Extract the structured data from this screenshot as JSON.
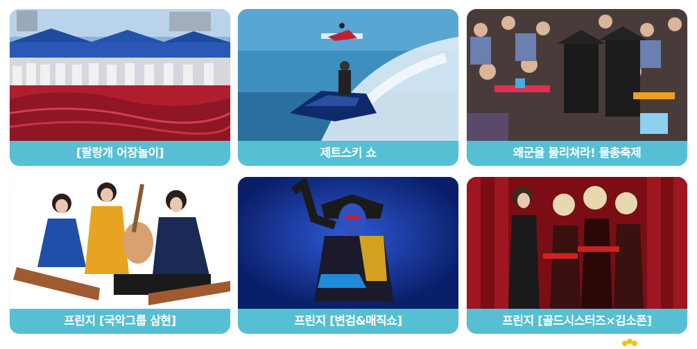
{
  "cards": [
    {
      "caption": "[팔랑개 어장놀이]",
      "image": "fishing-ground-festival-photo"
    },
    {
      "caption": "제트스키 쇼",
      "image": "jet-ski-photo"
    },
    {
      "caption": "왜군을 물리쳐라! 물총축제",
      "image": "water-gun-festival-photo"
    },
    {
      "caption": "프린지 [국악그룹 삼현]",
      "image": "gugak-group-photo"
    },
    {
      "caption": "프린지 [변검&매직쇼]",
      "image": "face-changing-magic-show-photo"
    },
    {
      "caption": "프린지 [골드시스터즈×김소폰]",
      "image": "gold-sisters-photo"
    }
  ],
  "colors": {
    "caption_bg": "#56bfd3",
    "caption_text": "#ffffff"
  }
}
